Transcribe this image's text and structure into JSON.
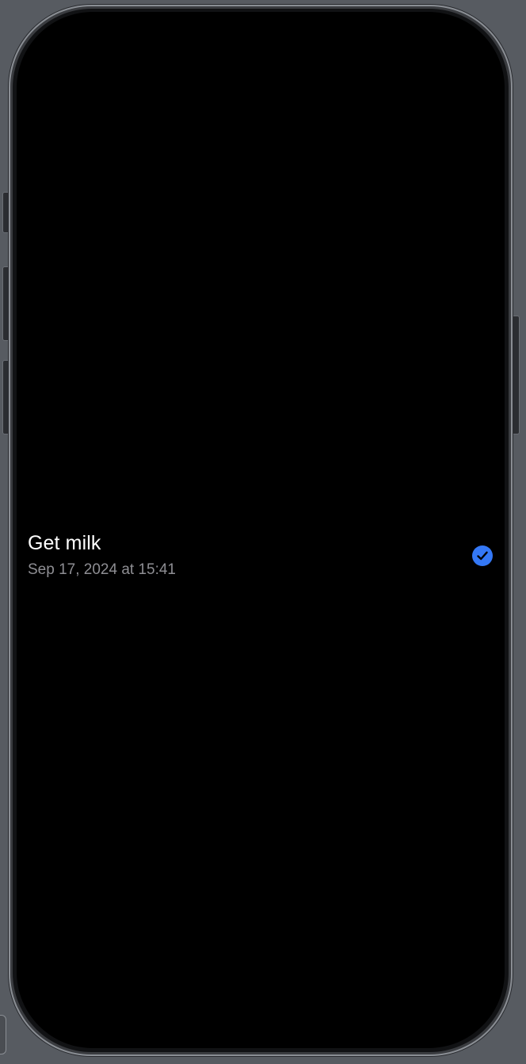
{
  "reminder": {
    "title": "Get milk",
    "date": "Sep 17, 2024 at 15:41",
    "completed": true
  },
  "colors": {
    "screen_background": "#000000",
    "title_text": "#ffffff",
    "date_text": "#8e8e93",
    "accent_check": "#3478f6",
    "simulator_background": "#575b61"
  },
  "icons": {
    "completed_indicator": "checkmark-circle-icon"
  }
}
